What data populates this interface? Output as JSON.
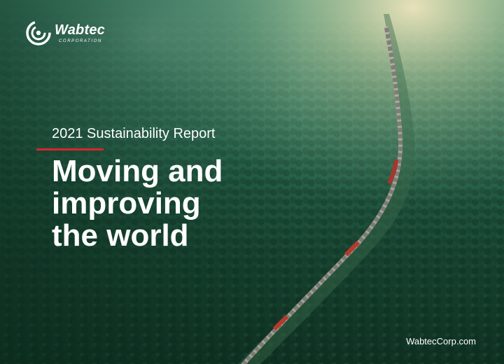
{
  "brand": {
    "name": "Wabtec",
    "subtitle": "CORPORATION",
    "logo_icon": "wabtec-logo-icon"
  },
  "cover": {
    "report_label": "2021 Sustainability Report",
    "headline": [
      "Moving and",
      "improving",
      "the world"
    ],
    "website": "WabtecCorp.com"
  },
  "colors": {
    "accent_red": "#d8262f",
    "forest_dark": "#0f3a2a",
    "haze_light": "#e9e2b8",
    "text": "#ffffff"
  },
  "background": {
    "description_icon": "forest-railway-photo"
  }
}
